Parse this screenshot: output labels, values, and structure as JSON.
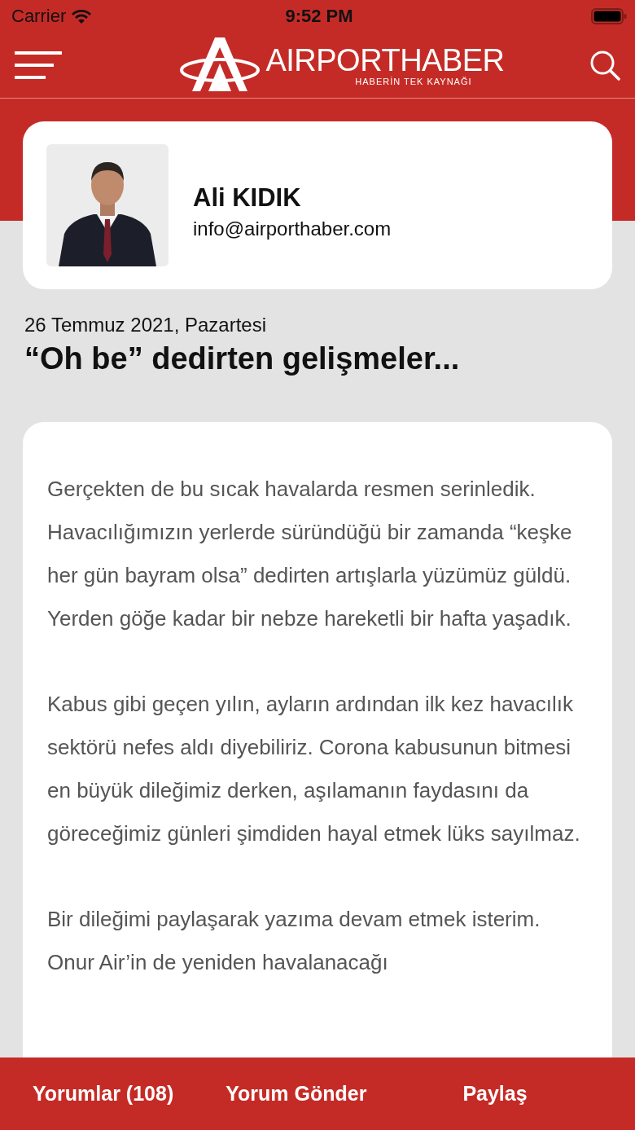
{
  "status_bar": {
    "carrier": "Carrier",
    "time": "9:52 PM"
  },
  "header": {
    "brand": "AIRPORTHABER",
    "tagline": "HABERİN TEK KAYNAĞI"
  },
  "author": {
    "name": "Ali KIDIK",
    "email": "info@airporthaber.com"
  },
  "article": {
    "date": "26 Temmuz 2021, Pazartesi",
    "title": "“Oh be” dedirten gelişmeler...",
    "paragraphs": [
      "Gerçekten de bu sıcak havalarda resmen serinledik. Havacılığımızın yerlerde süründüğü bir zamanda “keşke her gün bayram olsa” dedirten artışlarla yüzümüz güldü. Yerden göğe kadar bir nebze hareketli bir hafta yaşadık.",
      "Kabus gibi geçen yılın, ayların ardından ilk kez havacılık sektörü nefes aldı diyebiliriz. Corona kabusunun bitmesi en büyük dileğimiz derken, aşılamanın faydasını da göreceğimiz günleri şimdiden hayal etmek lüks sayılmaz.",
      "Bir dileğimi paylaşarak yazıma devam etmek isterim. Onur Air’in de yeniden havalanacağı"
    ]
  },
  "bottom_bar": [
    "Yorumlar (108)",
    "Yorum Gönder",
    "Paylaş"
  ]
}
